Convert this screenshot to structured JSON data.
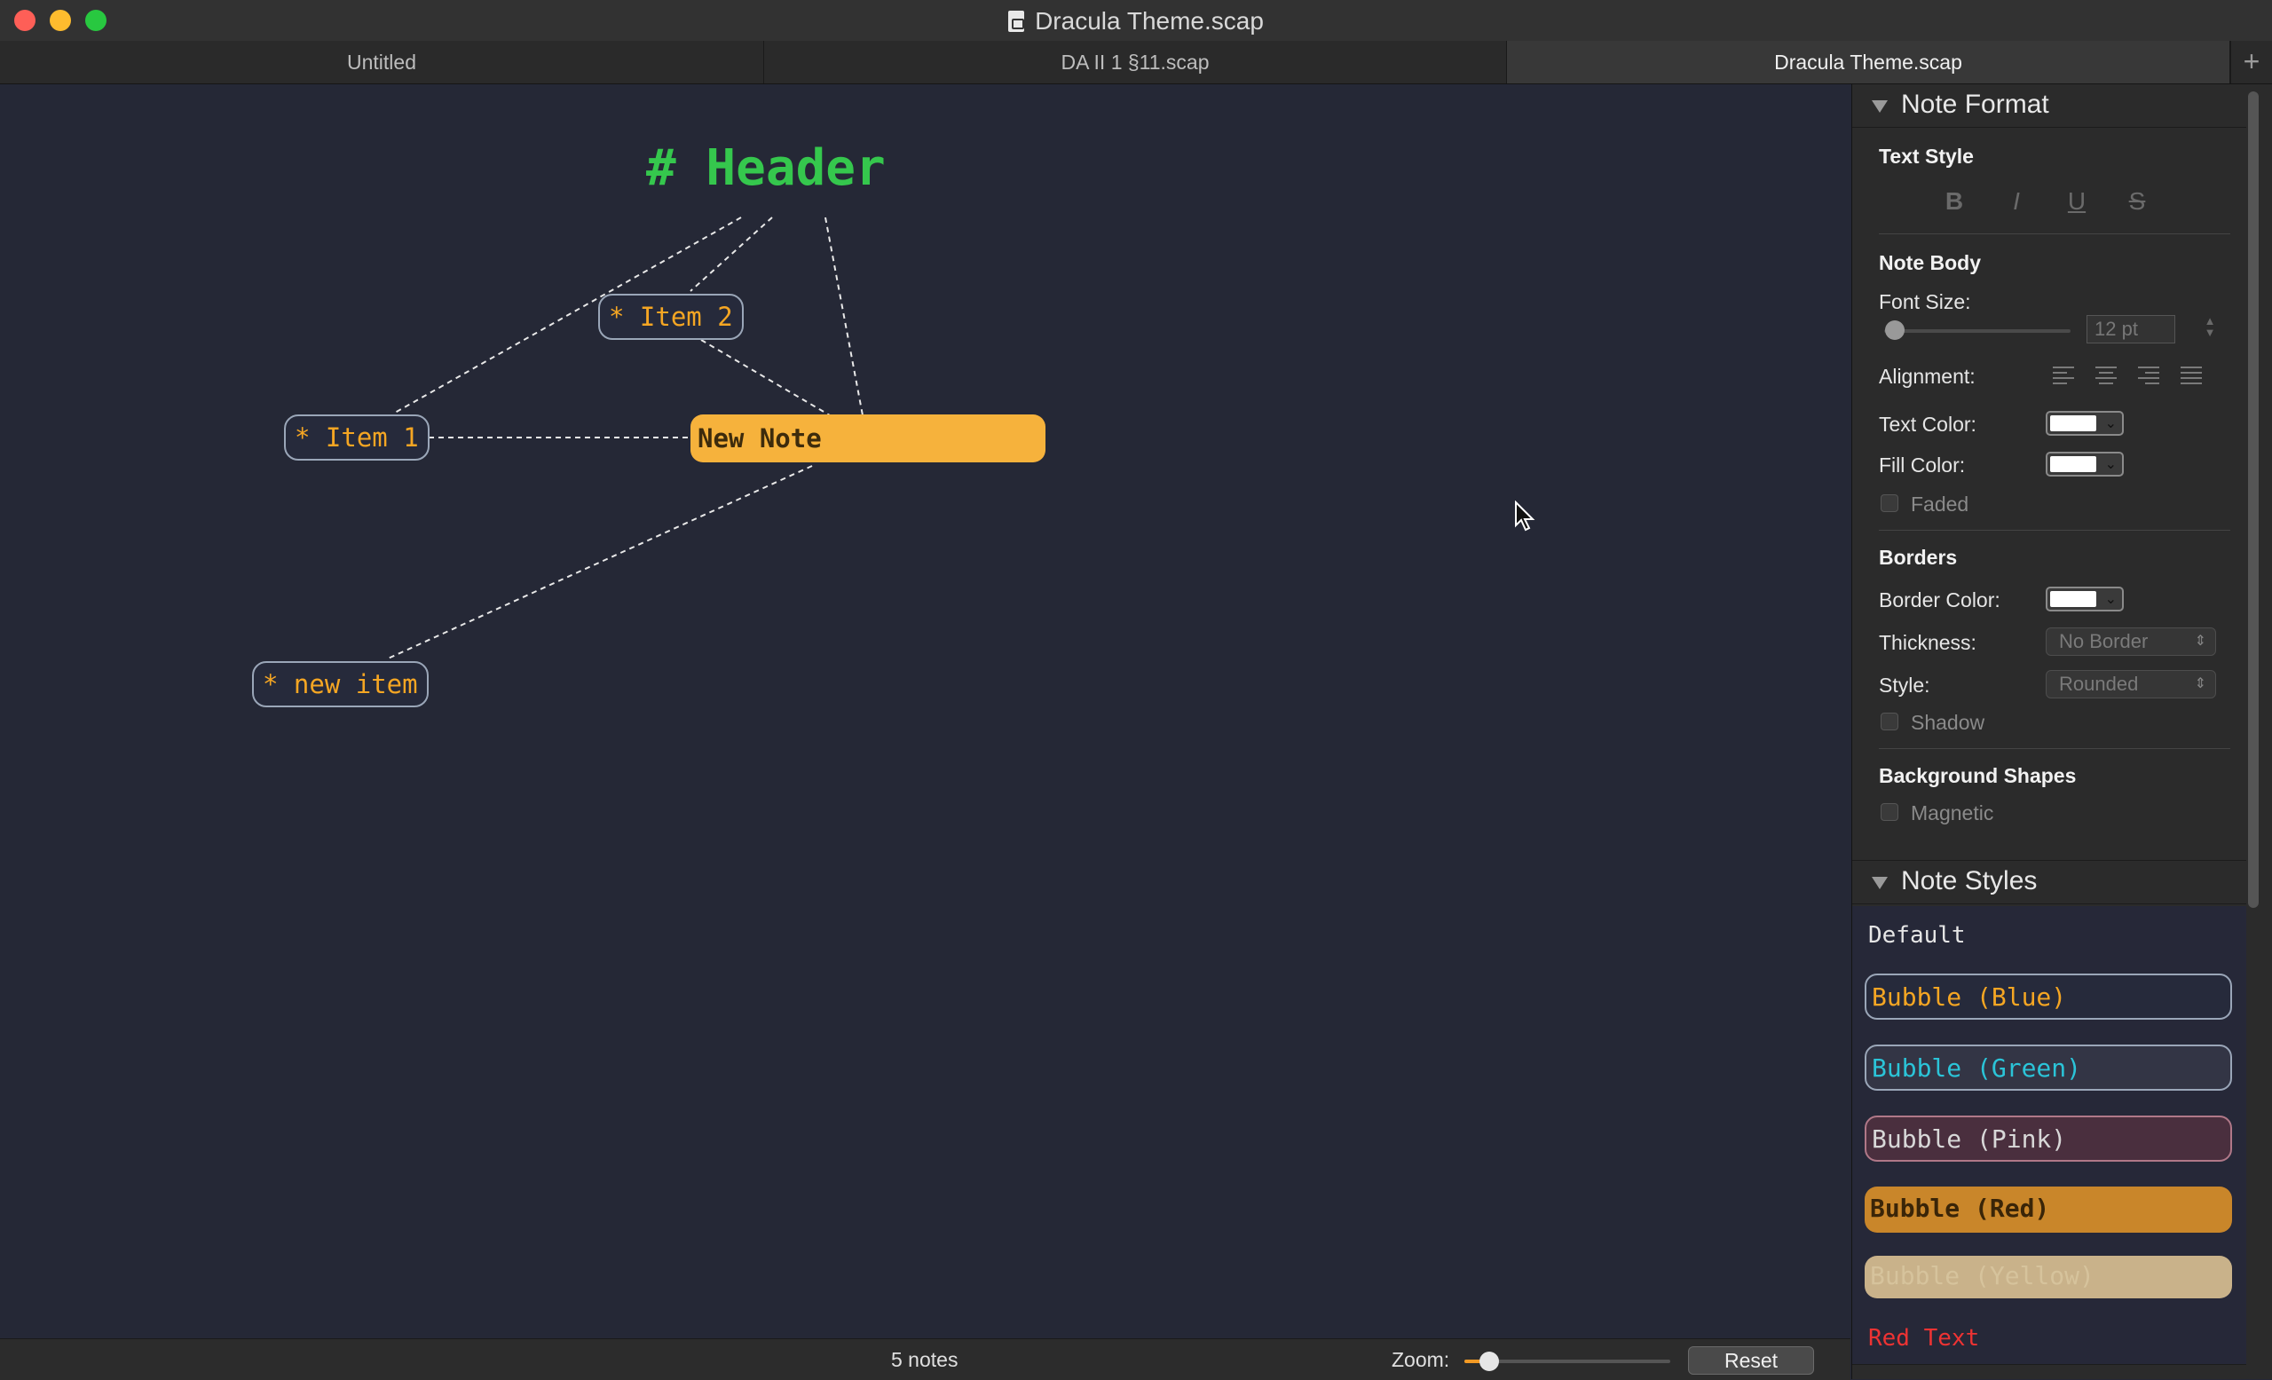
{
  "window": {
    "title": "Dracula Theme.scap"
  },
  "tabs": [
    {
      "label": "Untitled",
      "active": false
    },
    {
      "label": "DA II 1 §11.scap",
      "active": false
    },
    {
      "label": "Dracula Theme.scap",
      "active": true
    }
  ],
  "tab_add_label": "+",
  "canvas": {
    "notes": [
      {
        "text": "# Header",
        "style": "header"
      },
      {
        "text": "* Item 2",
        "style": "bubble"
      },
      {
        "text": "* Item 1",
        "style": "bubble"
      },
      {
        "text": "New Note",
        "style": "selected"
      },
      {
        "text": "* new item",
        "style": "bubble"
      }
    ]
  },
  "status": {
    "note_count": "5 notes",
    "zoom_label": "Zoom:",
    "zoom_fraction": 0.12,
    "reset_label": "Reset"
  },
  "sidebar": {
    "note_format": {
      "title": "Note Format",
      "text_style": {
        "heading": "Text Style",
        "buttons": [
          "B",
          "I",
          "U",
          "S"
        ]
      },
      "note_body": {
        "heading": "Note Body",
        "font_size_label": "Font Size:",
        "font_size_value": "12 pt",
        "alignment_label": "Alignment:",
        "text_color_label": "Text Color:",
        "fill_color_label": "Fill Color:",
        "faded_label": "Faded"
      },
      "borders": {
        "heading": "Borders",
        "border_color_label": "Border Color:",
        "thickness_label": "Thickness:",
        "thickness_value": "No Border",
        "style_label": "Style:",
        "style_value": "Rounded",
        "shadow_label": "Shadow"
      },
      "background_shapes": {
        "heading": "Background Shapes",
        "magnetic_label": "Magnetic"
      }
    },
    "note_styles": {
      "title": "Note Styles",
      "items": [
        "Default",
        "Bubble (Blue)",
        "Bubble (Green)",
        "Bubble (Pink)",
        "Bubble (Red)",
        "Bubble (Yellow)",
        "Red Text"
      ]
    }
  },
  "colors": {
    "canvas_bg": "#252836",
    "header_green": "#35c74d",
    "note_orange": "#f5a623",
    "selected_fill": "#f6b23c",
    "zoom_accent": "#f39a24"
  }
}
